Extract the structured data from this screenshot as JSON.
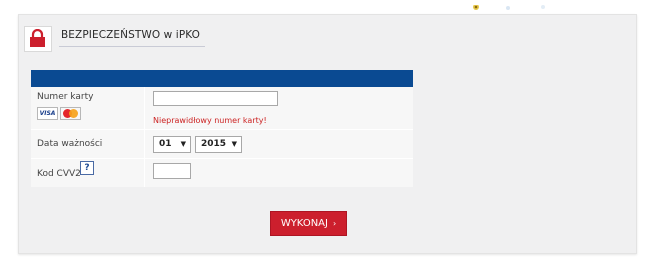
{
  "section": {
    "title": "BEZPIECZEŃSTWO w iPKO",
    "icon": "lock-icon"
  },
  "form": {
    "card_number": {
      "label": "Numer karty",
      "value": "",
      "error": "Nieprawidłowy numer karty!",
      "brand_icons": [
        "visa-icon",
        "mastercard-icon"
      ],
      "visa_text": "VISA"
    },
    "expiry": {
      "label": "Data ważności",
      "month": "01",
      "year": "2015",
      "arrow": "▼"
    },
    "cvv": {
      "label": "Kod CVV2",
      "help": "?",
      "value": ""
    }
  },
  "submit": {
    "label": "WYKONAJ",
    "chevron": "›"
  },
  "colors": {
    "header_bar": "#0a4a92",
    "accent_red": "#cc1f2d",
    "error_text": "#cc2323"
  }
}
